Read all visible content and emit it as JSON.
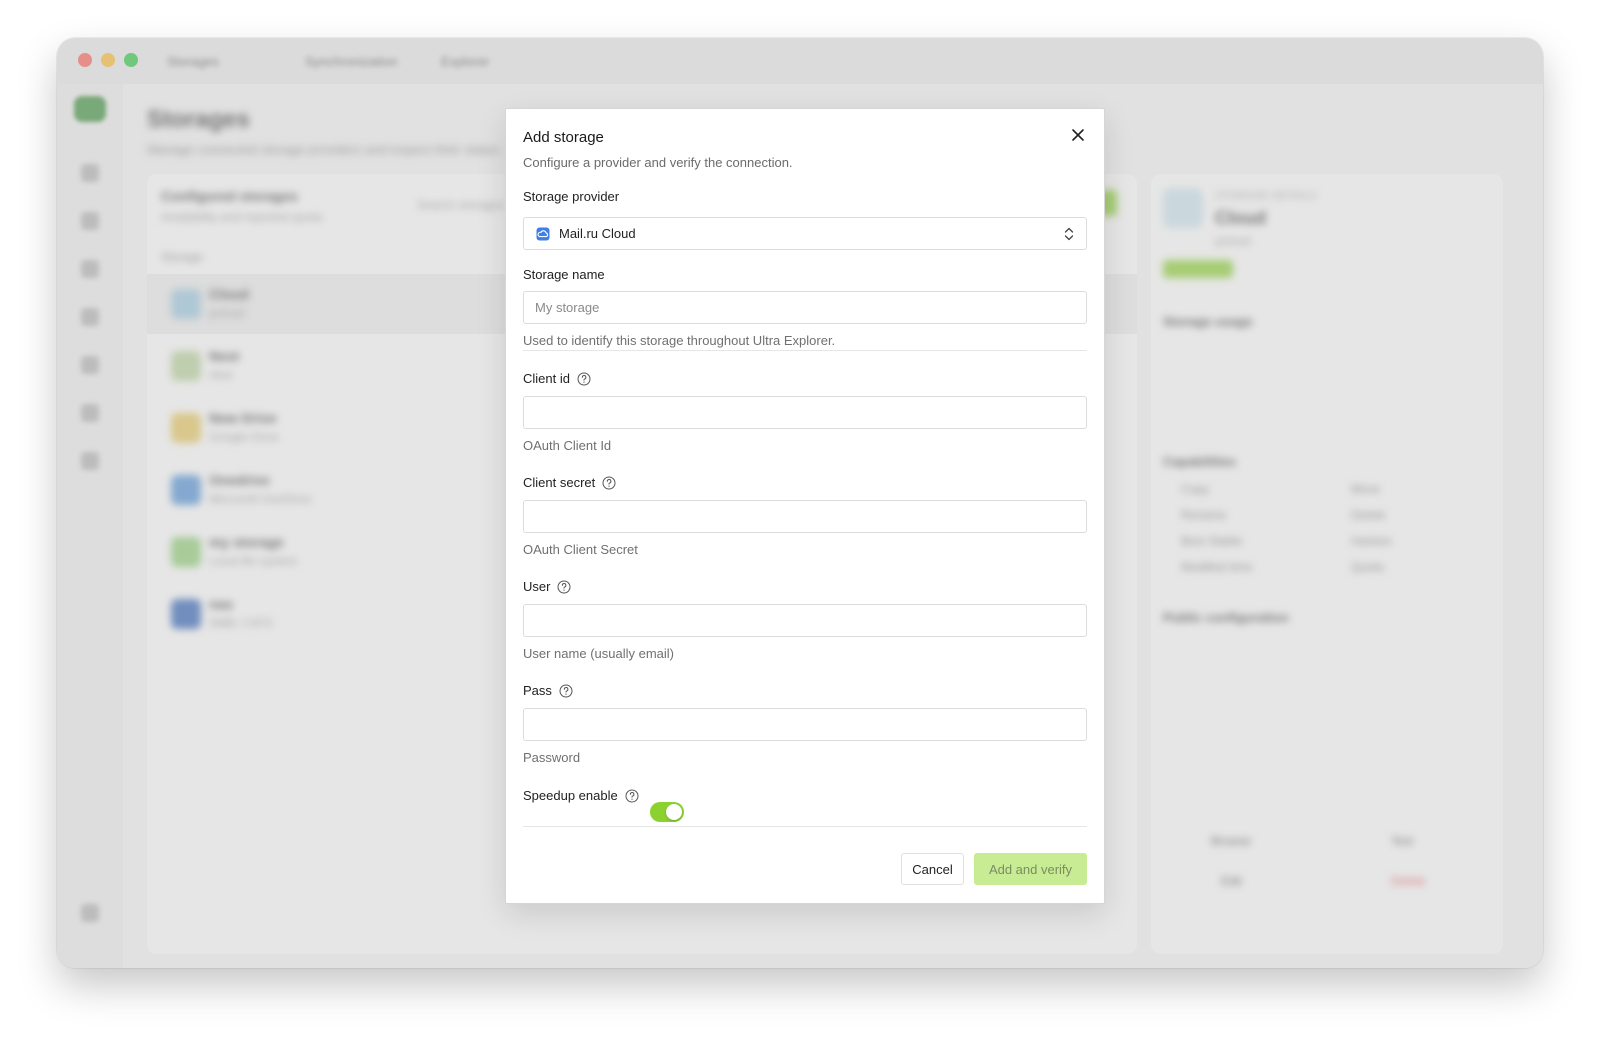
{
  "colors": {
    "accent": "#8bd130",
    "primary_disabled_bg": "#c8ec93",
    "primary_disabled_text": "#7a8d60",
    "provider_icon": "#3d7fe6"
  },
  "window": {
    "tabs": [
      "Storages",
      "Synchronization",
      "Explorer"
    ]
  },
  "background": {
    "page_title": "Storages",
    "page_subtitle": "Manage connected storage providers and inspect their status",
    "list_title": "Configured storages",
    "list_subtitle": "Availability and reported quota",
    "column_storage": "Storage",
    "search_placeholder": "Search storages",
    "rows": [
      {
        "name": "Cloud",
        "type": "pcloud"
      },
      {
        "name": "Nest",
        "type": "nfsd"
      },
      {
        "name": "New Drive",
        "type": "Google Drive"
      },
      {
        "name": "Onedrive",
        "type": "Microsoft OneDrive"
      },
      {
        "name": "my storage",
        "type": "Local file system"
      },
      {
        "name": "nas",
        "type": "SMB / CIFS"
      }
    ],
    "details_label": "STORAGE DETAILS",
    "details_name": "Cloud",
    "details_type": "pcloud",
    "details_status": "Available",
    "usage_title": "Storage usage",
    "capabilities_title": "Capabilities",
    "capabilities": [
      "Copy",
      "Move",
      "Rename",
      "Delete",
      "Best Stable",
      "Hashes",
      "Modified time",
      "Quota"
    ],
    "public_config_title": "Public configuration",
    "actions": [
      "Browse",
      "Test",
      "Edit",
      "Delete"
    ]
  },
  "dialog": {
    "title": "Add storage",
    "subtitle": "Configure a provider and verify the connection.",
    "provider_label": "Storage provider",
    "provider_value": "Mail.ru Cloud",
    "name_label": "Storage name",
    "name_placeholder": "My storage",
    "name_hint": "Used to identify this storage throughout Ultra Explorer.",
    "client_id_label": "Client id",
    "client_id_hint": "OAuth Client Id",
    "client_secret_label": "Client secret",
    "client_secret_hint": "OAuth Client Secret",
    "user_label": "User",
    "user_hint": "User name (usually email)",
    "pass_label": "Pass",
    "pass_hint": "Password",
    "speedup_label": "Speedup enable",
    "speedup_enabled": true,
    "cancel_label": "Cancel",
    "submit_label": "Add and verify"
  }
}
